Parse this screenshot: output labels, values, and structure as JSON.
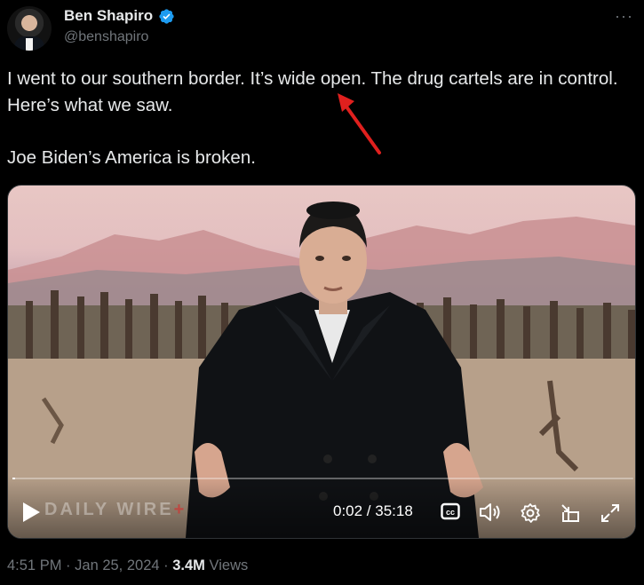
{
  "author": {
    "name": "Ben Shapiro",
    "handle": "@benshapiro",
    "verified_color": "#1d9bf0"
  },
  "more_label": "···",
  "tweet": {
    "paragraph1": "I went to our southern border. It’s wide open. The drug cartels are in control. Here’s what we saw.",
    "paragraph2": "Joe Biden’s America is broken."
  },
  "video": {
    "watermark": "DAILY WIRE",
    "watermark_plus": "+",
    "timecode": "0:02 / 35:18",
    "progress": 0.001,
    "cc_label": "cc"
  },
  "meta": {
    "time": "4:51 PM",
    "date": "Jan 25, 2024",
    "views_count": "3.4M",
    "views_label": "Views",
    "separator": "·"
  },
  "annotation_color": "#e0201e"
}
